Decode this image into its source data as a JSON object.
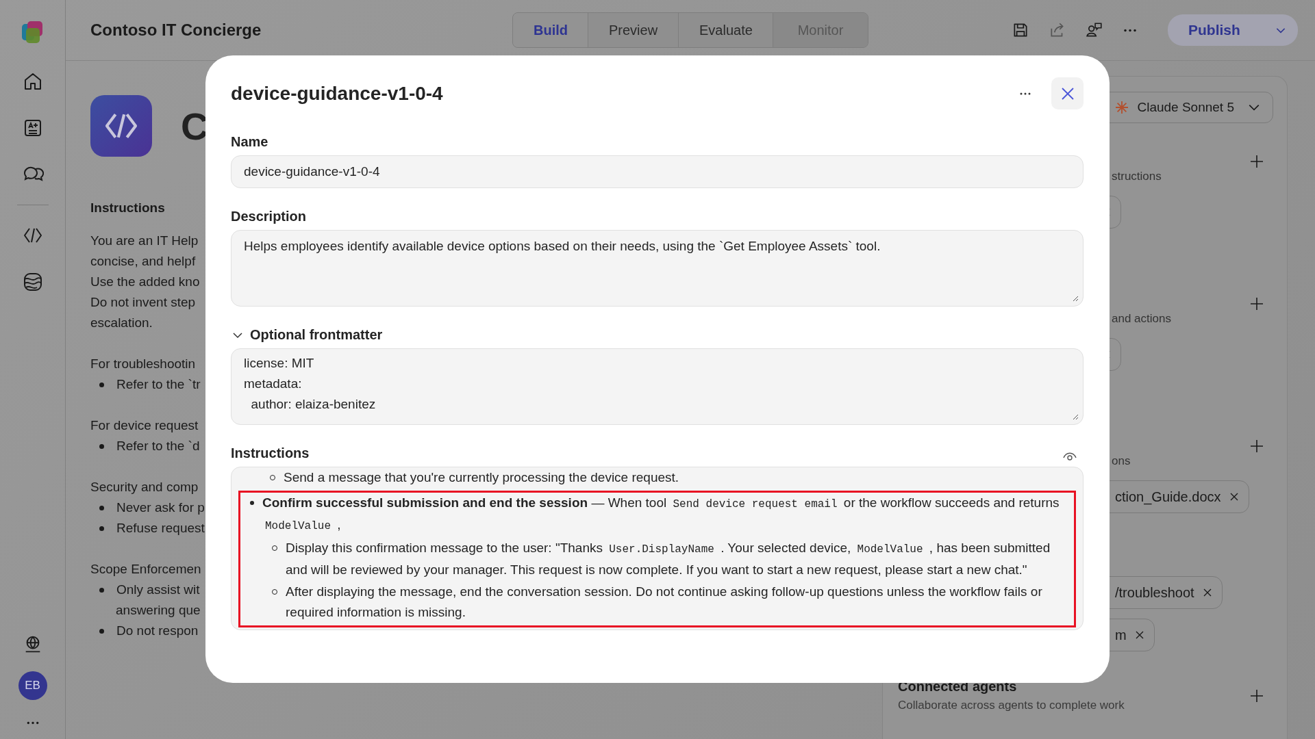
{
  "app_title": "Contoso IT Concierge",
  "tabs": [
    {
      "label": "Build",
      "selected": true,
      "disabled": false
    },
    {
      "label": "Preview",
      "selected": false,
      "disabled": false
    },
    {
      "label": "Evaluate",
      "selected": false,
      "disabled": false
    },
    {
      "label": "Monitor",
      "selected": false,
      "disabled": true
    }
  ],
  "publish_label": "Publish",
  "user_initials": "EB",
  "agent": {
    "name": "C",
    "instructions_heading": "Instructions",
    "blocks": [
      [
        {
          "kind": "text",
          "text": "You are an IT Help"
        },
        {
          "kind": "text",
          "text": "concise, and helpf"
        },
        {
          "kind": "text",
          "text": "Use the added kno"
        },
        {
          "kind": "text",
          "text": "Do not invent step"
        },
        {
          "kind": "text",
          "text": "escalation."
        }
      ],
      [
        {
          "kind": "text",
          "text": "For troubleshootin"
        },
        {
          "kind": "bullet",
          "text": "Refer to the `tr"
        }
      ],
      [
        {
          "kind": "text",
          "text": "For device request"
        },
        {
          "kind": "bullet",
          "text": "Refer to the `d"
        }
      ],
      [
        {
          "kind": "text",
          "text": "Security and comp"
        },
        {
          "kind": "bullet",
          "text": "Never ask for p"
        },
        {
          "kind": "bullet",
          "text": "Refuse request"
        }
      ],
      [
        {
          "kind": "text",
          "text": "Scope Enforcemen"
        },
        {
          "kind": "bullet",
          "text": "Only assist wit"
        },
        {
          "kind": "continued",
          "text": "answering que"
        },
        {
          "kind": "bullet",
          "text": "Do not respon"
        }
      ]
    ]
  },
  "right_panel": {
    "model": "Claude Sonnet 5",
    "sections": [
      {
        "label": "structions",
        "addable": true,
        "chips": [
          {
            "kind": "cut"
          }
        ]
      },
      {
        "label": "and actions",
        "addable": true,
        "chips": [
          {
            "kind": "cut"
          }
        ]
      },
      {
        "label": "ons",
        "addable": true,
        "chips": [
          {
            "kind": "label",
            "text": "ction_Guide.docx"
          }
        ]
      },
      {
        "addable": false,
        "chips": [
          {
            "kind": "label",
            "text": "/troubleshoot"
          },
          {
            "kind": "label",
            "text": "m"
          }
        ]
      }
    ],
    "connected": {
      "title": "Connected agents",
      "subtitle": "Collaborate across agents to complete work",
      "addable": true
    }
  },
  "modal": {
    "title": "device-guidance-v1-0-4",
    "name_label": "Name",
    "name_value": "device-guidance-v1-0-4",
    "description_label": "Description",
    "description_value": "Helps employees identify available device options based on their needs, using the `Get Employee Assets` tool.",
    "frontmatter_label": "Optional frontmatter",
    "frontmatter_expanded": true,
    "frontmatter_lines": [
      "license: MIT",
      "metadata:",
      "  author: elaiza-benitez"
    ],
    "instructions_label": "Instructions",
    "instructions": [
      {
        "highlighted": false,
        "children": [
          {
            "parts": [
              {
                "kind": "text",
                "text": "Send a message that you're currently processing the device request."
              }
            ]
          }
        ]
      },
      {
        "highlighted": true,
        "parts": [
          {
            "kind": "bold",
            "text": "Confirm successful submission and end the session"
          },
          {
            "kind": "text",
            "text": " — When tool "
          },
          {
            "kind": "code",
            "text": "Send device request email"
          },
          {
            "kind": "text",
            "text": " or the workflow succeeds and returns "
          },
          {
            "kind": "code",
            "text": "ModelValue"
          },
          {
            "kind": "text",
            "text": " ,"
          }
        ],
        "children": [
          {
            "parts": [
              {
                "kind": "text",
                "text": "Display this confirmation message to the user: \"Thanks "
              },
              {
                "kind": "code",
                "text": "User.DisplayName"
              },
              {
                "kind": "text",
                "text": " . Your selected device, "
              },
              {
                "kind": "code",
                "text": "ModelValue"
              },
              {
                "kind": "text",
                "text": " , has been submitted and will be reviewed by your manager. This request is now complete. If you want to start a new request, please start a new chat.\""
              }
            ]
          },
          {
            "parts": [
              {
                "kind": "text",
                "text": "After displaying the message, end the conversation session. Do not continue asking follow-up questions unless the workflow fails or required information is missing."
              }
            ]
          }
        ]
      }
    ]
  }
}
